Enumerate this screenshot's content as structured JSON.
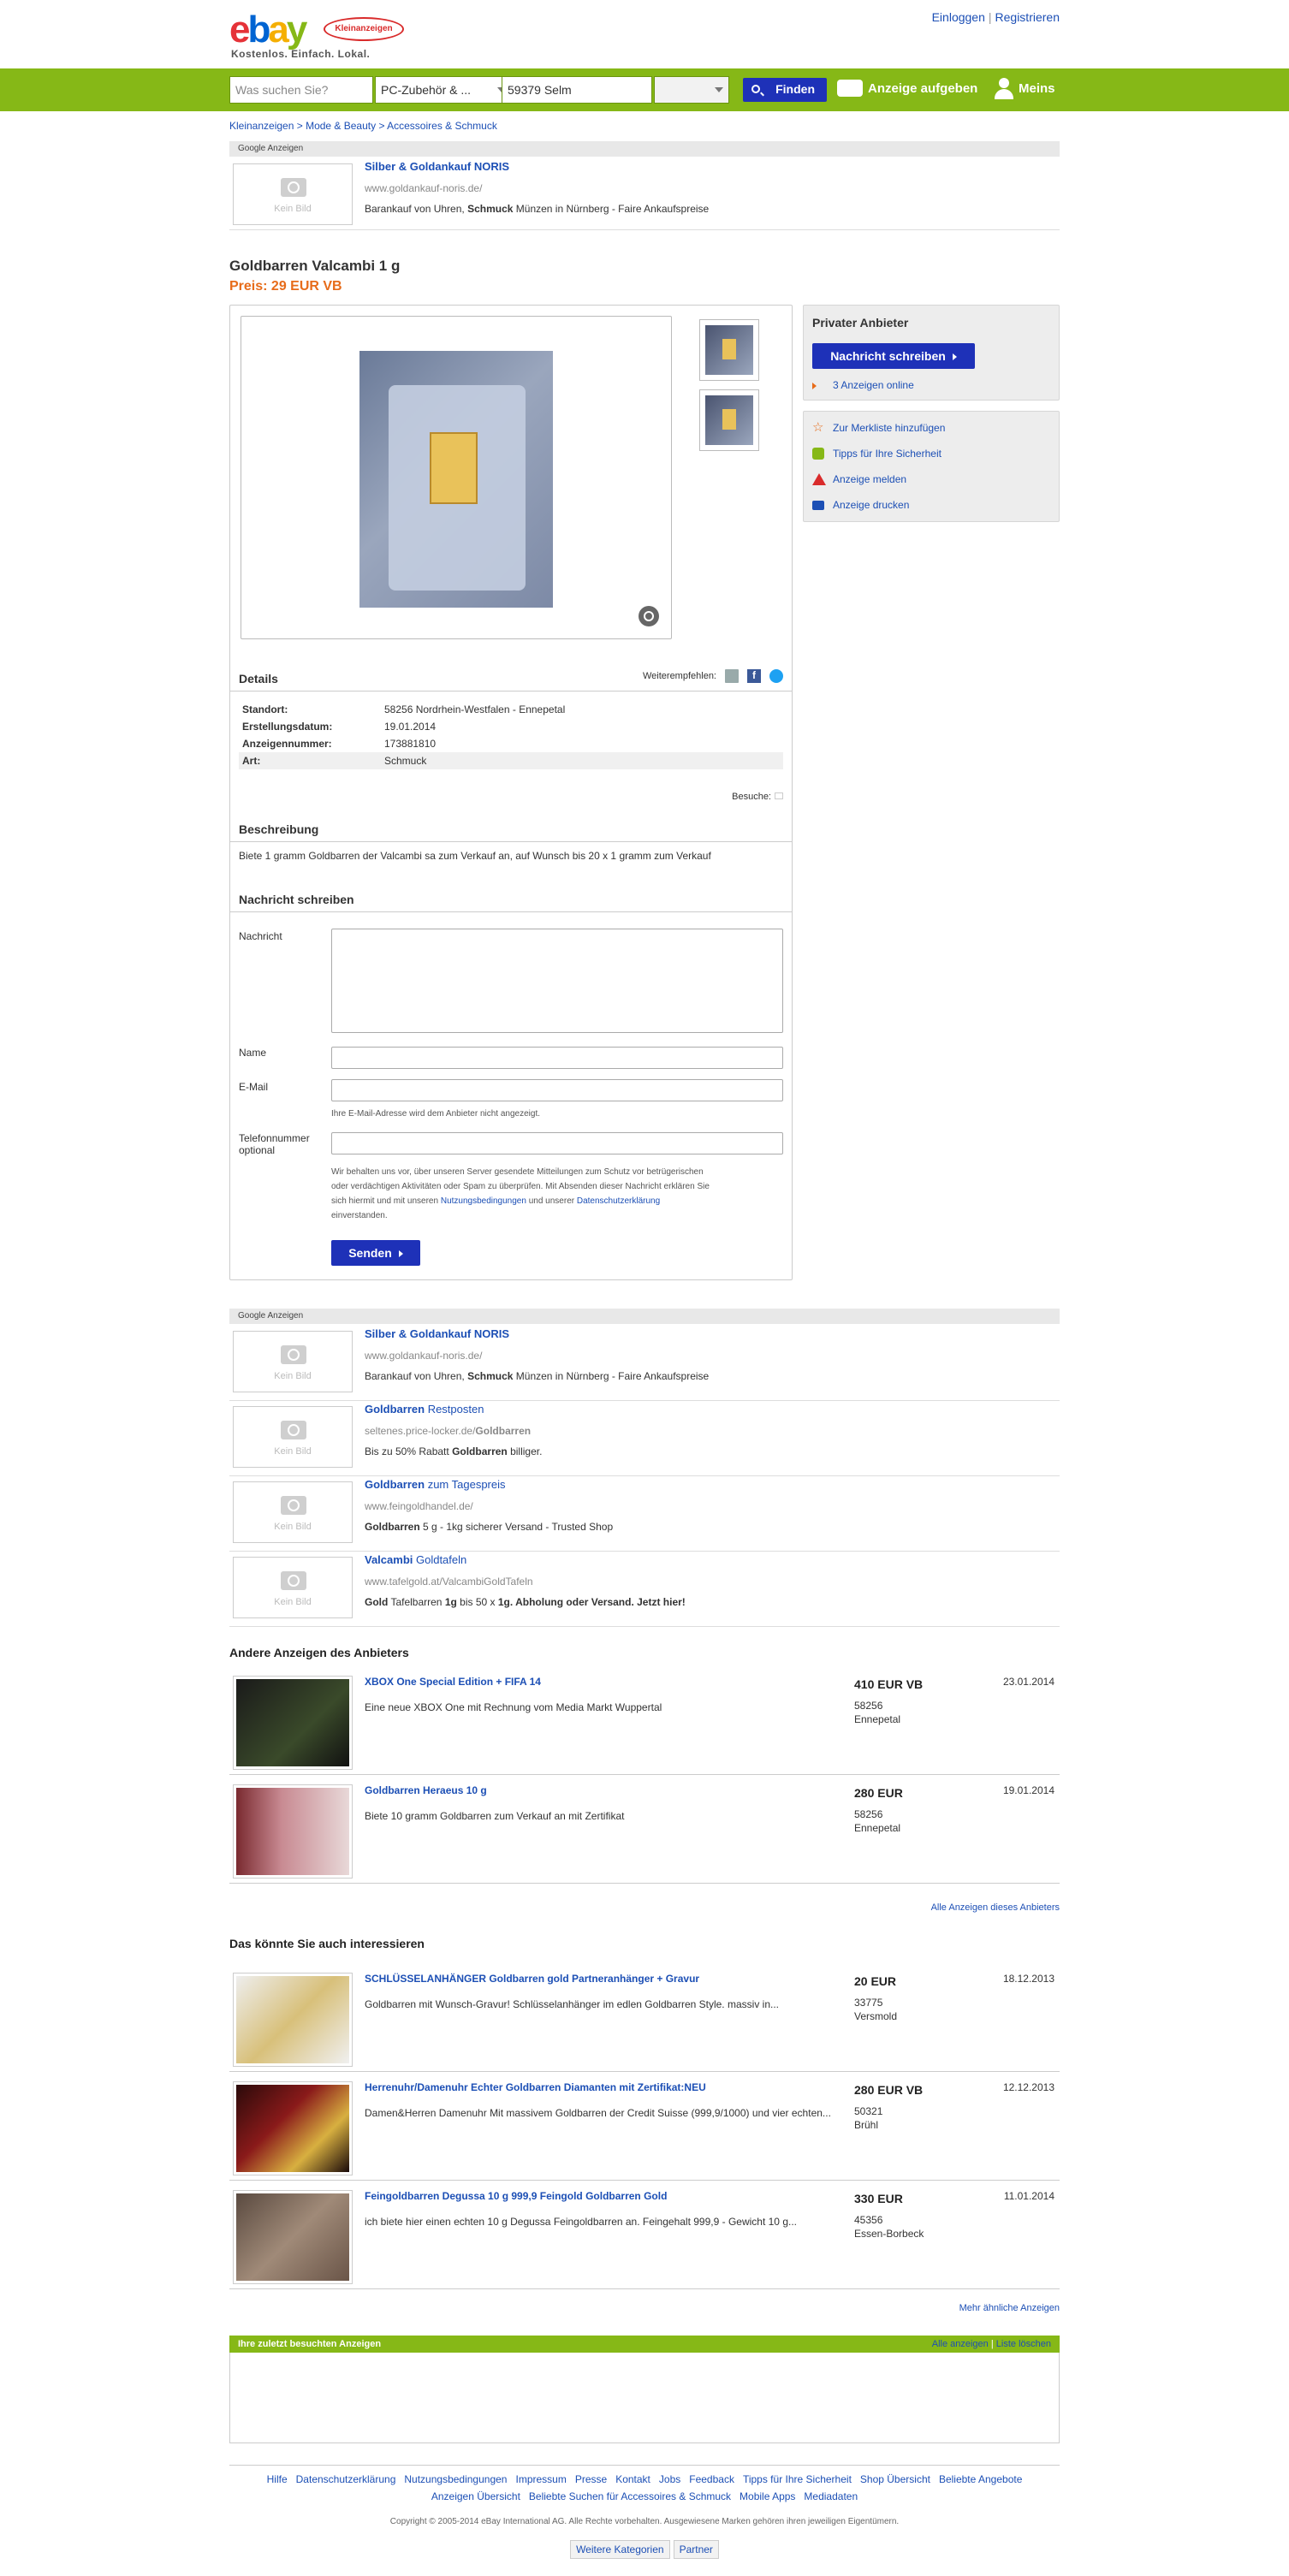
{
  "header": {
    "logo_text": [
      "e",
      "b",
      "a",
      "y"
    ],
    "badge": "Kleinanzeigen",
    "tagline": "Kostenlos. Einfach. Lokal.",
    "login": "Einloggen",
    "register": "Registrieren"
  },
  "search": {
    "what_placeholder": "Was suchen Sie?",
    "category": "PC-Zubehör & ...",
    "location": "59379 Selm",
    "radius": "",
    "find": "Finden",
    "post_ad": "Anzeige aufgeben",
    "meins": "Meins"
  },
  "breadcrumb": "Kleinanzeigen > Mode & Beauty > Accessoires & Schmuck",
  "gads_label": "Google Anzeigen",
  "nopic_label": "Kein Bild",
  "top_ad": {
    "title": "Silber & Goldankauf NORIS",
    "url": "www.goldankauf-noris.de/",
    "desc_a": "Barankauf von Uhren, ",
    "desc_b": "Schmuck",
    "desc_c": " Münzen in Nürnberg - Faire Ankaufspreise"
  },
  "listing": {
    "title": "Goldbarren Valcambi 1 g",
    "price": "Preis: 29 EUR VB"
  },
  "details": {
    "title": "Details",
    "share_label": "Weiterempfehlen:",
    "rows": [
      {
        "k": "Standort:",
        "v": "58256 Nordrhein-Westfalen - Ennepetal"
      },
      {
        "k": "Erstellungsdatum:",
        "v": "19.01.2014"
      },
      {
        "k": "Anzeigennummer:",
        "v": "173881810"
      },
      {
        "k": "Art:",
        "v": "Schmuck"
      }
    ],
    "visits": "Besuche:"
  },
  "description": {
    "title": "Beschreibung",
    "text": "Biete 1 gramm Goldbarren der Valcambi sa zum Verkauf an, auf Wunsch bis 20 x 1 gramm zum Verkauf"
  },
  "message": {
    "title": "Nachricht schreiben",
    "label_message": "Nachricht",
    "label_name": "Name",
    "label_email": "E-Mail",
    "email_hint": "Ihre E-Mail-Adresse wird dem Anbieter nicht angezeigt.",
    "label_phone": "Telefonnummer optional",
    "legal_1": "Wir behalten uns vor, über unseren Server gesendete Mitteilungen zum Schutz vor betrügerischen",
    "legal_2": "oder verdächtigen Aktivitäten oder Spam zu überprüfen. Mit Absenden dieser Nachricht erklären Sie",
    "legal_3": "sich hiermit und mit unseren ",
    "legal_link1": "Nutzungsbedingungen",
    "legal_4": " und unserer ",
    "legal_link2": "Datenschutzerklärung",
    "legal_5": "einverstanden.",
    "send": "Senden"
  },
  "seller": {
    "title": "Privater Anbieter",
    "write": "Nachricht schreiben",
    "online": "3 Anzeigen online",
    "watchlist": "Zur Merkliste hinzufügen",
    "safety": "Tipps für Ihre Sicherheit",
    "report": "Anzeige melden",
    "print": "Anzeige drucken"
  },
  "bottom_ads": [
    {
      "title_a": "Silber & Goldankauf NORIS",
      "title_b": "",
      "url_a": "www.goldankauf-noris.de/",
      "url_b": "",
      "desc_a": "Barankauf von Uhren, ",
      "desc_b": "Schmuck",
      "desc_c": " Münzen in Nürnberg - Faire Ankaufspreise",
      "desc_d": "",
      "desc_e": "",
      "desc_f": ""
    },
    {
      "title_a": "Goldbarren",
      "title_b": " Restposten",
      "url_a": "seltenes.price-locker.de/",
      "url_b": "Goldbarren",
      "desc_a": "Bis zu 50% Rabatt ",
      "desc_b": "Goldbarren",
      "desc_c": " billiger.",
      "desc_d": "",
      "desc_e": "",
      "desc_f": ""
    },
    {
      "title_a": "Goldbarren",
      "title_b": " zum Tagespreis",
      "url_a": "www.feingoldhandel.de/",
      "url_b": "",
      "desc_a": "",
      "desc_b": "Goldbarren",
      "desc_c": " 5 g - 1kg sicherer Versand - Trusted Shop",
      "desc_d": "",
      "desc_e": "",
      "desc_f": ""
    },
    {
      "title_a": "Valcambi",
      "title_b": " Goldtafeln",
      "url_a": "www.tafelgold.at/",
      "url_b": "ValcambiGoldTafeln",
      "desc_a": "",
      "desc_b": "Gold",
      "desc_c": " Tafelbarren ",
      "desc_d": "1g",
      "desc_e": " bis 50 x ",
      "desc_f": "1g. Abholung oder Versand. Jetzt hier!"
    }
  ],
  "other_title": "Andere Anzeigen des Anbieters",
  "other_ads": [
    {
      "title": "XBOX One Special Edition + FIFA 14",
      "desc": "Eine neue XBOX One mit Rechnung vom Media Markt Wuppertal",
      "price": "410 EUR VB",
      "zip": "58256",
      "city": "Ennepetal",
      "date": "23.01.2014"
    },
    {
      "title": "Goldbarren Heraeus 10 g",
      "desc": "Biete 10 gramm Goldbarren zum Verkauf an mit Zertifikat",
      "price": "280 EUR",
      "zip": "58256",
      "city": "Ennepetal",
      "date": "19.01.2014"
    }
  ],
  "all_seller_ads": "Alle Anzeigen dieses Anbieters",
  "interest_title": "Das könnte Sie auch interessieren",
  "interest_ads": [
    {
      "title": "SCHLÜSSELANHÄNGER Goldbarren gold Partneranhänger + Gravur",
      "desc": "Goldbarren mit Wunsch-Gravur! Schlüsselanhänger im edlen Goldbarren Style. massiv in...",
      "price": "20 EUR",
      "zip": "33775",
      "city": "Versmold",
      "date": "18.12.2013"
    },
    {
      "title": "Herrenuhr/Damenuhr Echter Goldbarren Diamanten mit Zertifikat:NEU",
      "desc": "Damen&Herren Damenuhr Mit massivem Goldbarren der Credit Suisse (999,9/1000) und vier echten...",
      "price": "280 EUR VB",
      "zip": "50321",
      "city": "Brühl",
      "date": "12.12.2013"
    },
    {
      "title": "Feingoldbarren Degussa 10 g 999,9 Feingold Goldbarren Gold",
      "desc": "ich biete hier einen echten 10 g Degussa Feingoldbarren an. Feingehalt 999,9 - Gewicht 10 g...",
      "price": "330 EUR",
      "zip": "45356",
      "city": "Essen-Borbeck",
      "date": "11.01.2014"
    }
  ],
  "more_similar": "Mehr ähnliche Anzeigen",
  "recent": {
    "title": "Ihre zuletzt besuchten Anzeigen",
    "all": "Alle anzeigen",
    "sep": "|",
    "clear": "Liste löschen"
  },
  "footer": {
    "links1": [
      "Hilfe",
      "Datenschutzerklärung",
      "Nutzungsbedingungen",
      "Impressum",
      "Presse",
      "Kontakt",
      "Jobs",
      "Feedback",
      "Tipps für Ihre Sicherheit",
      "Shop Übersicht",
      "Beliebte Angebote"
    ],
    "links2": [
      "Anzeigen Übersicht",
      "Beliebte Suchen für Accessoires & Schmuck",
      "Mobile Apps",
      "Mediadaten"
    ],
    "copyright": "Copyright © 2005-2014 eBay International AG. Alle Rechte vorbehalten. Ausgewiesene Marken gehören ihren jeweiligen Eigentümern.",
    "btn1": "Weitere Kategorien",
    "btn2": "Partner"
  }
}
